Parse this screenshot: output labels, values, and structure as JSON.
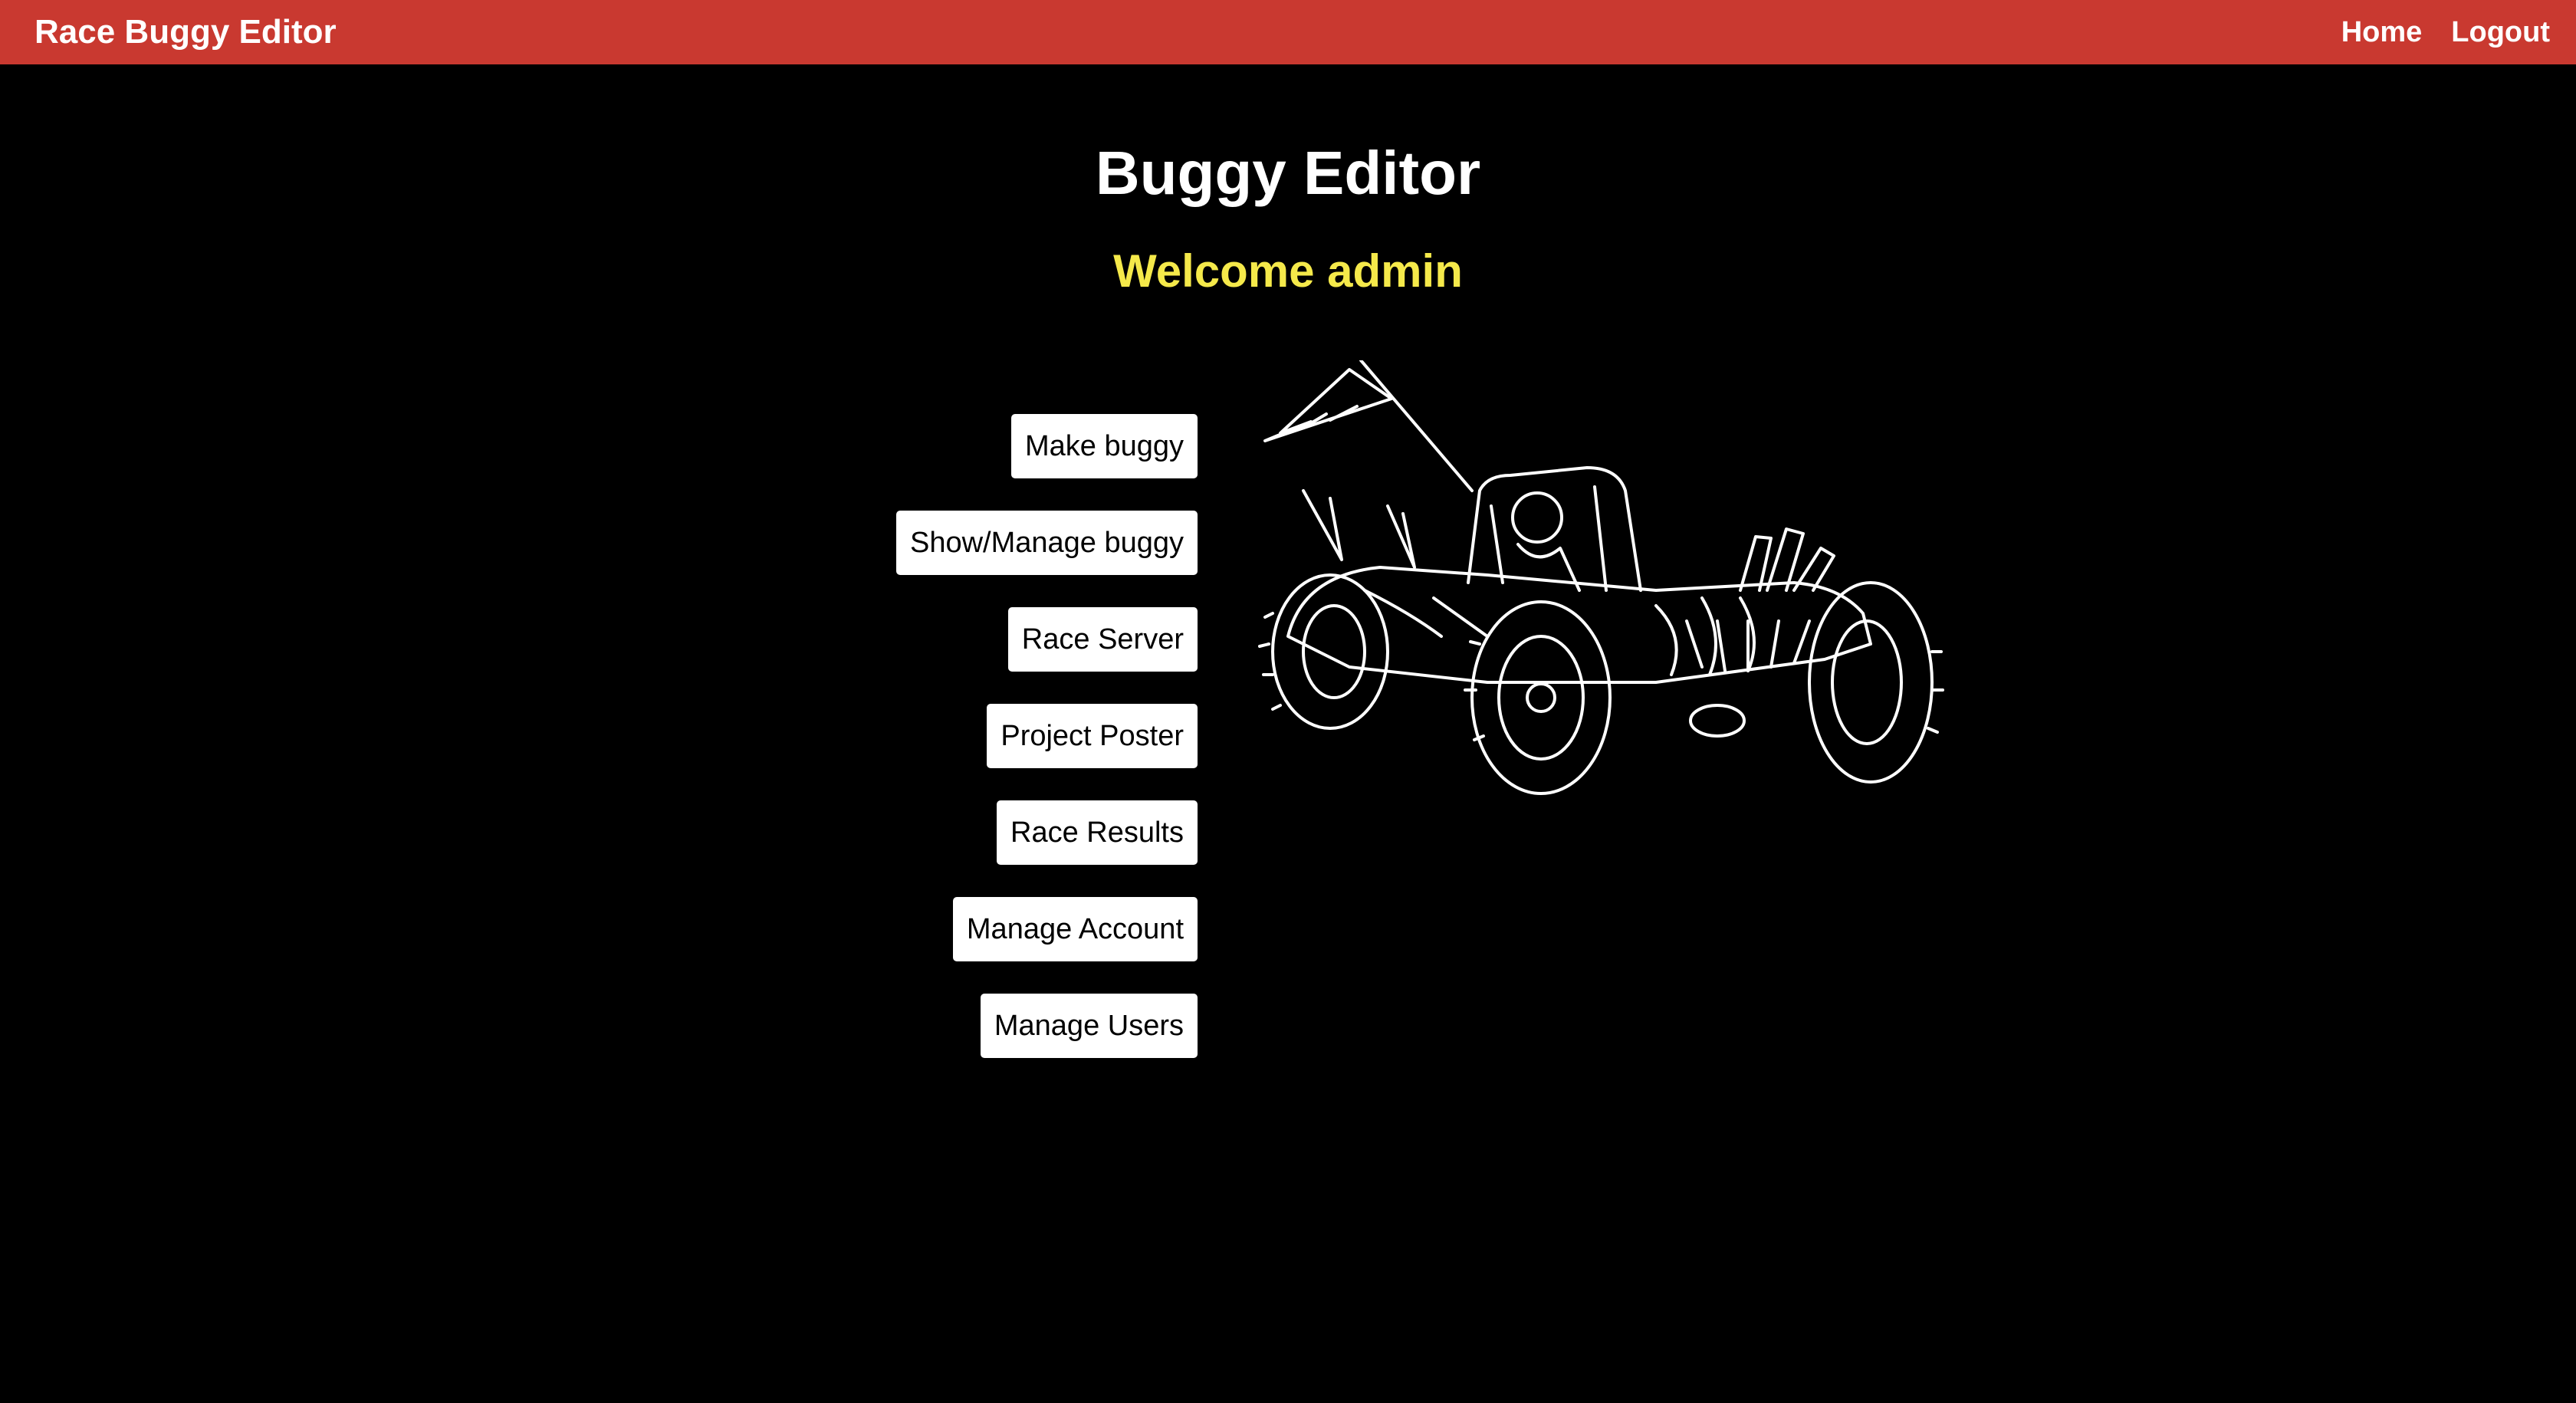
{
  "topbar": {
    "brand": "Race Buggy Editor",
    "nav": [
      {
        "label": "Home"
      },
      {
        "label": "Logout"
      }
    ],
    "color": "#c93930"
  },
  "main": {
    "title": "Buggy Editor",
    "welcome": "Welcome admin",
    "welcome_color": "#f5e94a",
    "buttons": [
      {
        "label": "Make buggy"
      },
      {
        "label": "Show/Manage buggy"
      },
      {
        "label": "Race Server"
      },
      {
        "label": "Project Poster"
      },
      {
        "label": "Race Results"
      },
      {
        "label": "Manage Account"
      },
      {
        "label": "Manage Users"
      }
    ],
    "illustration": "buggy-sketch"
  }
}
